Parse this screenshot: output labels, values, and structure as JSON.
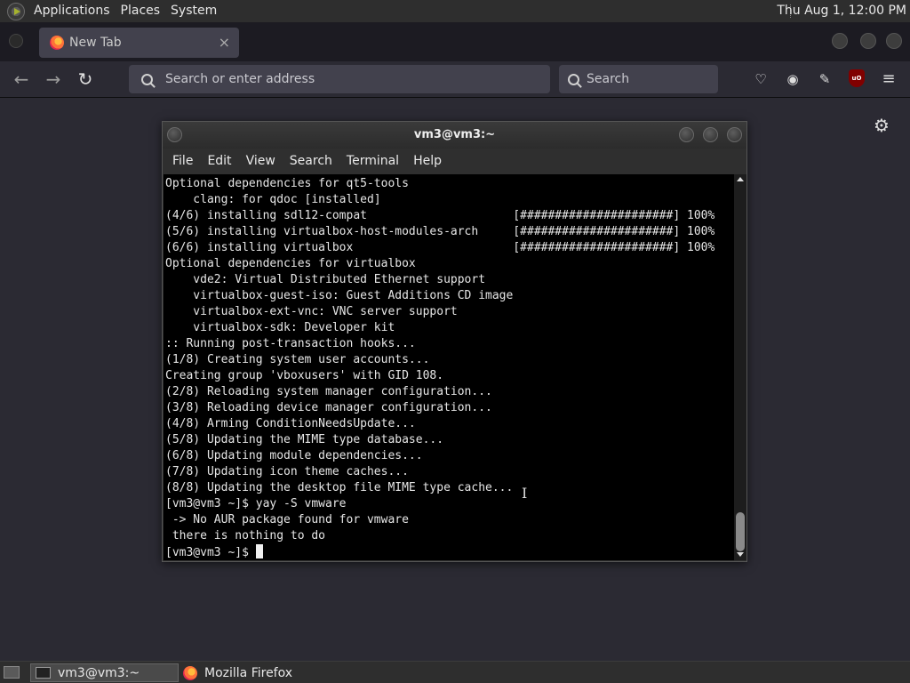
{
  "top_panel": {
    "menus": [
      "Applications",
      "Places",
      "System"
    ],
    "clock": "Thu Aug  1, 12:00 PM"
  },
  "firefox": {
    "tab_label": "New Tab",
    "tab_close": "×",
    "urlbar_placeholder": "Search or enter address",
    "searchbar_placeholder": "Search",
    "ublock_badge": "uO"
  },
  "terminal": {
    "title": "vm3@vm3:~",
    "menu": [
      "File",
      "Edit",
      "View",
      "Search",
      "Terminal",
      "Help"
    ],
    "lines": [
      "Optional dependencies for qt5-tools",
      "    clang: for qdoc [installed]",
      "(4/6) installing sdl12-compat                     [######################] 100%",
      "(5/6) installing virtualbox-host-modules-arch     [######################] 100%",
      "(6/6) installing virtualbox                       [######################] 100%",
      "Optional dependencies for virtualbox",
      "    vde2: Virtual Distributed Ethernet support",
      "    virtualbox-guest-iso: Guest Additions CD image",
      "    virtualbox-ext-vnc: VNC server support",
      "    virtualbox-sdk: Developer kit",
      ":: Running post-transaction hooks...",
      "(1/8) Creating system user accounts...",
      "Creating group 'vboxusers' with GID 108.",
      "(2/8) Reloading system manager configuration...",
      "(3/8) Reloading device manager configuration...",
      "(4/8) Arming ConditionNeedsUpdate...",
      "(5/8) Updating the MIME type database...",
      "(6/8) Updating module dependencies...",
      "(7/8) Updating icon theme caches...",
      "(8/8) Updating the desktop file MIME type cache...",
      "[vm3@vm3 ~]$ yay -S vmware",
      " -> No AUR package found for vmware",
      " there is nothing to do"
    ],
    "prompt": "[vm3@vm3 ~]$ "
  },
  "taskbar": {
    "items": [
      "vm3@vm3:~",
      "Mozilla Firefox"
    ]
  }
}
